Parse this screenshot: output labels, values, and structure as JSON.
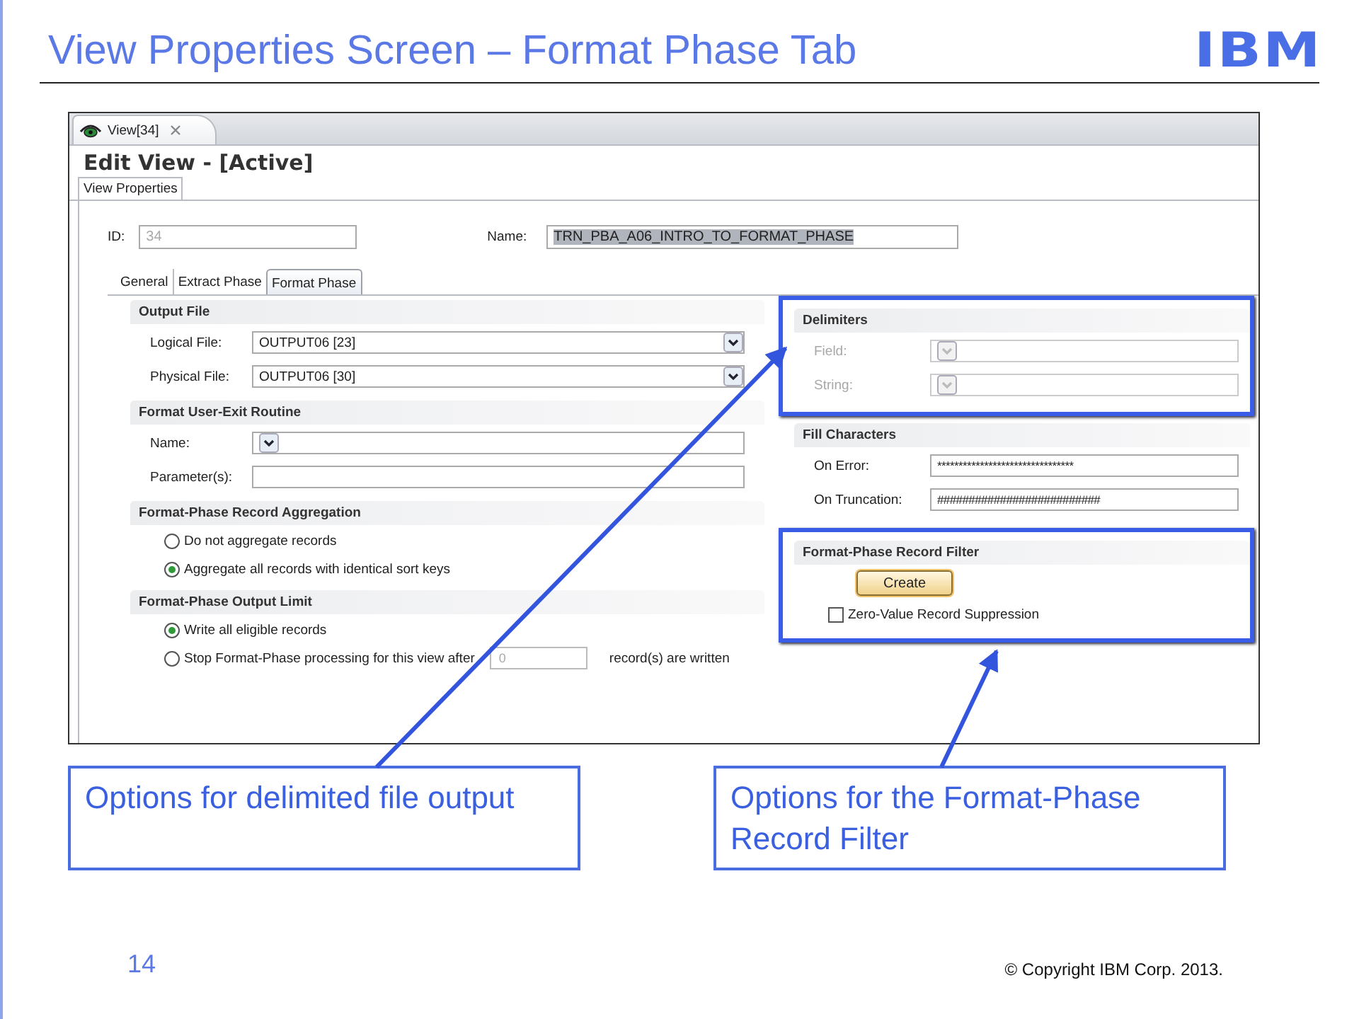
{
  "slide": {
    "title": "View Properties Screen – Format Phase Tab",
    "logo": "IBM",
    "page_number": "14",
    "copyright": "© Copyright  IBM Corp. 2013."
  },
  "editor_tab": {
    "label": "View[34]"
  },
  "view_title": "Edit View - [Active]",
  "outer_tabs": [
    {
      "label": "View Properties",
      "selected": true
    }
  ],
  "id_field": {
    "label": "ID:",
    "value": "34",
    "disabled": true
  },
  "name_field": {
    "label": "Name:",
    "value": "TRN_PBA_A06_INTRO_TO_FORMAT_PHASE",
    "text_selected": true
  },
  "phase_tabs": [
    {
      "label": "General",
      "selected": false
    },
    {
      "label": "Extract Phase",
      "selected": false
    },
    {
      "label": "Format Phase",
      "selected": true
    }
  ],
  "left_sections": [
    {
      "title": "Output File",
      "rows": [
        {
          "kind": "dropdown",
          "label": "Logical File:",
          "value": "OUTPUT06 [23]"
        },
        {
          "kind": "dropdown",
          "label": "Physical File:",
          "value": "OUTPUT06 [30]"
        }
      ]
    },
    {
      "title": "Format User-Exit Routine",
      "rows": [
        {
          "kind": "dropdown",
          "label": "Name:"
        },
        {
          "kind": "text",
          "label": "Parameter(s):"
        }
      ]
    },
    {
      "title": "Format-Phase Record Aggregation",
      "rows": [
        {
          "kind": "radio",
          "label": "Do not aggregate records",
          "selected": false
        },
        {
          "kind": "radio",
          "label": "Aggregate all records with identical sort keys",
          "selected": true
        }
      ]
    },
    {
      "title": "Format-Phase Output Limit",
      "rows": [
        {
          "kind": "radio",
          "label": "Write all eligible records",
          "selected": true
        },
        {
          "kind": "radio_input",
          "label": "Stop Format-Phase processing for this view after",
          "selected": false,
          "value": "0",
          "value_disabled": true,
          "suffix": "record(s) are written"
        }
      ]
    }
  ],
  "right_sections": [
    {
      "title": "Delimiters",
      "disabled": true,
      "highlighted": true,
      "rows": [
        {
          "kind": "dropdown",
          "label": "Field:"
        },
        {
          "kind": "dropdown",
          "label": "String:"
        }
      ]
    },
    {
      "title": "Fill Characters",
      "disabled": false,
      "highlighted": false,
      "rows": [
        {
          "kind": "text",
          "label": "On Error:",
          "value": "********************************"
        },
        {
          "kind": "text",
          "label": "On Truncation:",
          "value": "##########################"
        }
      ]
    },
    {
      "title": "Format-Phase Record Filter",
      "disabled": false,
      "highlighted": true,
      "rows": [
        {
          "kind": "button",
          "label": "Create"
        },
        {
          "kind": "checkbox",
          "label": "Zero-Value Record Suppression",
          "checked": false
        }
      ]
    }
  ],
  "callouts": [
    {
      "text": "Options for delimited file output"
    },
    {
      "text": "Options for the Format-Phase Record Filter"
    }
  ]
}
